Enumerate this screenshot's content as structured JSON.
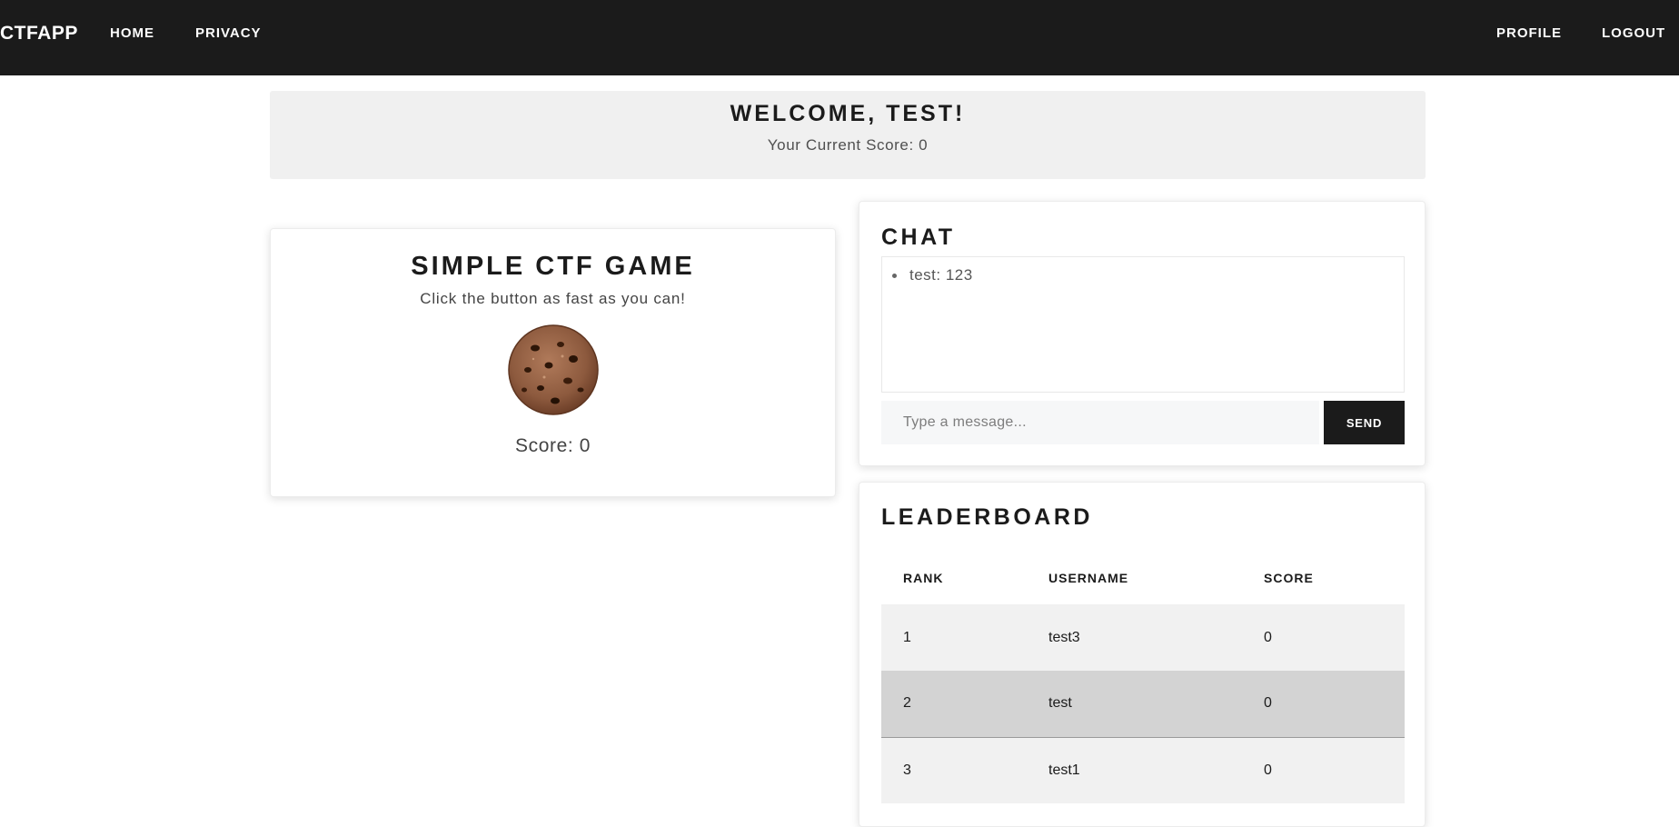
{
  "nav": {
    "brand": "CTFAPP",
    "links": [
      "HOME",
      "PRIVACY"
    ],
    "right_links": [
      "PROFILE",
      "LOGOUT"
    ]
  },
  "welcome": {
    "title": "WELCOME, TEST!",
    "score_text": "Your Current Score: 0"
  },
  "game": {
    "title": "SIMPLE CTF GAME",
    "subtitle": "Click the button as fast as you can!",
    "score_text": "Score: 0"
  },
  "chat": {
    "title": "CHAT",
    "messages": [
      "test: 123"
    ],
    "input_placeholder": "Type a message...",
    "send_label": "SEND"
  },
  "leaderboard": {
    "title": "LEADERBOARD",
    "headers": [
      "RANK",
      "USERNAME",
      "SCORE"
    ],
    "rows": [
      [
        "1",
        "test3",
        "0"
      ],
      [
        "2",
        "test",
        "0"
      ],
      [
        "3",
        "test1",
        "0"
      ]
    ]
  },
  "colors": {
    "navbar": "#1b1b1b",
    "panel": "#f0f0f0",
    "button": "#1b1b1b",
    "row_highlight": "#d3d3d3"
  }
}
